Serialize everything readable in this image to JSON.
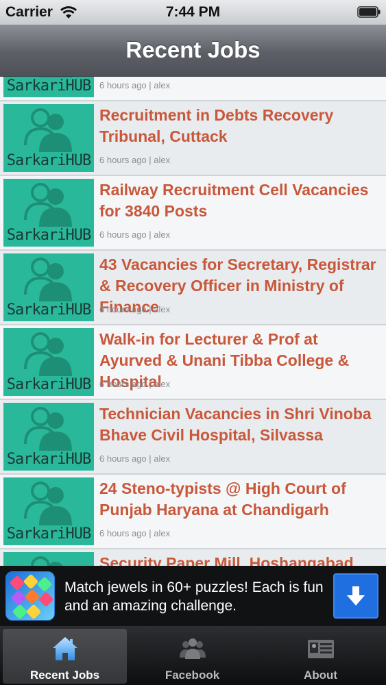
{
  "status_bar": {
    "carrier": "Carrier",
    "time": "7:44 PM"
  },
  "nav": {
    "title": "Recent Jobs"
  },
  "thumb_brand": "SarkariHUB",
  "jobs": [
    {
      "title": "",
      "meta": "6 hours ago | alex"
    },
    {
      "title": "Recruitment in Debts Recovery Tribunal, Cuttack",
      "meta": "6 hours ago | alex"
    },
    {
      "title": "Railway Recruitment Cell Vacancies for 3840 Posts",
      "meta": "6 hours ago | alex"
    },
    {
      "title": "43 Vacancies for Secretary, Registrar & Recovery Officer in Ministry of Finance",
      "meta": "6 hours ago | alex"
    },
    {
      "title": "Walk-in for Lecturer & Prof at Ayurved & Unani Tibba College & Hospital",
      "meta": "6 hours ago | alex"
    },
    {
      "title": "Technician Vacancies in Shri Vinoba Bhave Civil Hospital, Silvassa",
      "meta": "6 hours ago | alex"
    },
    {
      "title": "24 Steno-typists @ High Court of Punjab Haryana at Chandigarh",
      "meta": "6 hours ago | alex"
    },
    {
      "title": "Security Paper Mill, Hoshangabad",
      "meta": ""
    }
  ],
  "ad": {
    "text": "Match jewels in 60+ puzzles! Each is fun and an amazing challenge."
  },
  "tabs": [
    {
      "label": "Recent Jobs",
      "icon": "home-icon",
      "active": true
    },
    {
      "label": "Facebook",
      "icon": "people-icon",
      "active": false
    },
    {
      "label": "About",
      "icon": "id-card-icon",
      "active": false
    }
  ],
  "colors": {
    "accent": "#c9573a",
    "thumb": "#2ab89a",
    "ad_button": "#1f6fe0"
  }
}
